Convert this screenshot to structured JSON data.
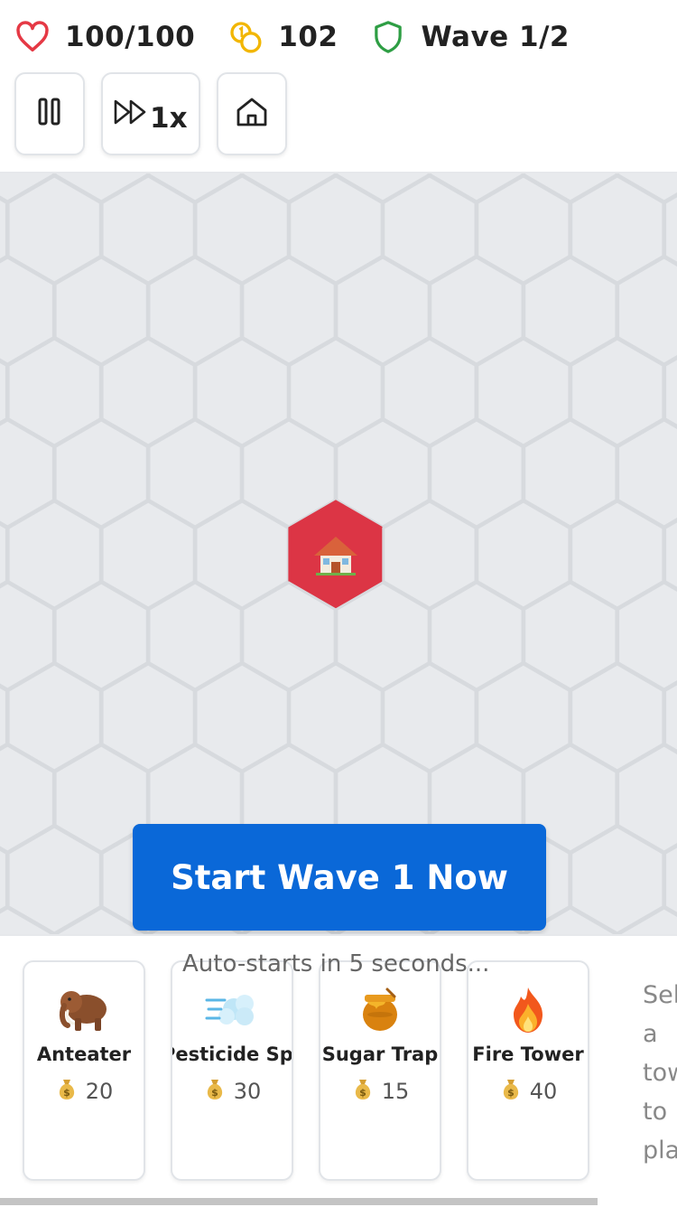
{
  "hud": {
    "health": "100/100",
    "coins": "102",
    "wave": "Wave 1/2"
  },
  "controls": {
    "pause_icon": "pause-icon",
    "speed_icon": "fast-forward-icon",
    "speed_label": "1x",
    "home_icon": "home-icon"
  },
  "board": {
    "base_icon": "house-icon",
    "base_color": "#dc3545",
    "tile_color": "#e8eaed"
  },
  "start_button": {
    "label": "Start Wave 1 Now"
  },
  "autostart_text": "Auto-starts in 5 seconds...",
  "towers": [
    {
      "name": "Anteater",
      "cost": "20",
      "icon": "mammoth-icon"
    },
    {
      "name": "Pesticide Spray",
      "cost": "30",
      "icon": "spray-icon"
    },
    {
      "name": "Sugar Trap",
      "cost": "15",
      "icon": "honey-pot-icon"
    },
    {
      "name": "Fire Tower",
      "cost": "40",
      "icon": "fire-icon"
    }
  ],
  "hint": [
    "Sel",
    "a",
    "tow",
    "to",
    "pla"
  ],
  "colors": {
    "accent": "#0a68d8",
    "health": "#e53945",
    "coins": "#f2b600",
    "wave": "#2e9e44"
  }
}
